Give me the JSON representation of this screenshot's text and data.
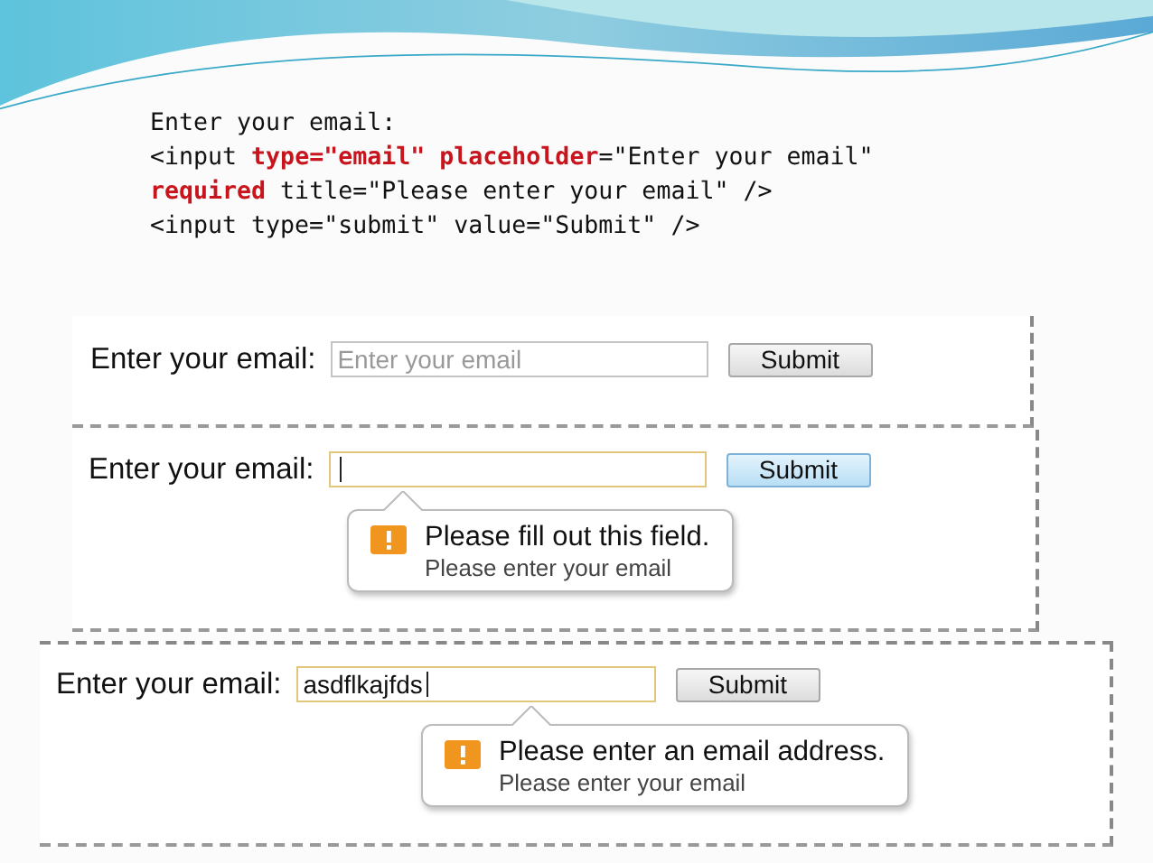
{
  "code_lines": [
    "Enter your email:",
    "<input **type=\"email\"** **placeholder**=\"Enter your email\"",
    "**required** title=\"Please enter your email\" />",
    "<input type=\"submit\" value=\"Submit\" />"
  ],
  "examples": [
    {
      "label": "Enter your email:",
      "placeholder": "Enter your email",
      "focused": false,
      "button": "Submit",
      "button_hover": false
    },
    {
      "label": "Enter your email:",
      "focused": true,
      "button": "Submit",
      "button_hover": true,
      "tooltip": {
        "message": "Please fill out this field.",
        "detail": "Please enter your email"
      }
    },
    {
      "label": "Enter your email:",
      "value": "asdflkajfds",
      "focused": true,
      "button": "Submit",
      "button_hover": false,
      "tooltip": {
        "message": "Please enter an email address.",
        "detail": "Please enter your email"
      }
    }
  ]
}
